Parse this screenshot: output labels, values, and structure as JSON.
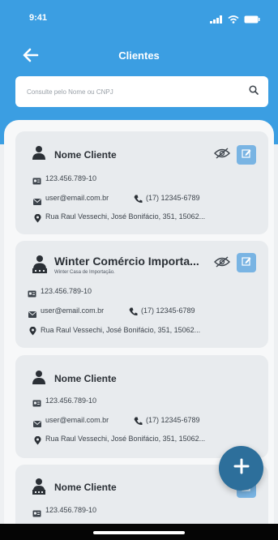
{
  "status_bar": {
    "time": "9:41"
  },
  "header": {
    "title": "Clientes"
  },
  "search": {
    "placeholder": "Consulte pelo Nome ou CNPJ"
  },
  "clients": [
    {
      "name": "Nome Cliente",
      "document": "123.456.789-10",
      "email": "user@email.com.br",
      "phone": "(17) 12345-6789",
      "address": "Rua Raul Vessechi, José Bonifácio, 351, 15062..."
    },
    {
      "name": "Winter Comércio Importa...",
      "subtitle": "Winter Casa de Importação.",
      "document": "123.456.789-10",
      "email": "user@email.com.br",
      "phone": "(17) 12345-6789",
      "address": "Rua Raul Vessechi, José Bonifácio, 351, 15062..."
    },
    {
      "name": "Nome Cliente",
      "document": "123.456.789-10",
      "email": "user@email.com.br",
      "phone": "(17) 12345-6789",
      "address": "Rua Raul Vessechi, José Bonifácio, 351, 15062..."
    },
    {
      "name": "Nome Cliente",
      "document": "123.456.789-10"
    }
  ],
  "fab": {
    "icon": "plus-icon",
    "symbol": "+"
  },
  "colors": {
    "header": "#3b9ee2",
    "fab": "#2d6f9b",
    "edit_button": "#79b4e3",
    "card": "#e8ebee"
  }
}
